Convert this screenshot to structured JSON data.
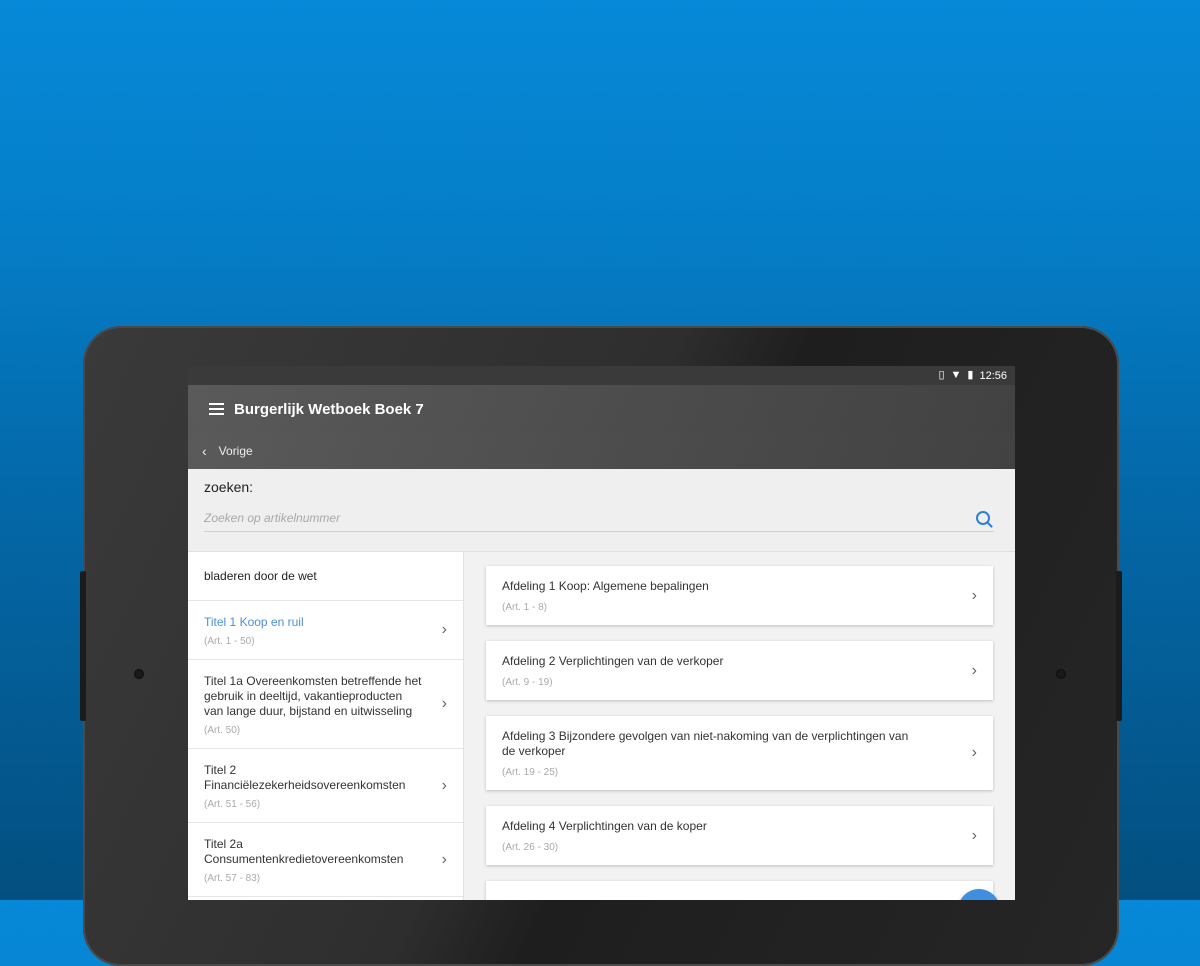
{
  "statusbar": {
    "time": "12:56",
    "icons": [
      "vibrate-icon",
      "wifi-icon",
      "battery-icon"
    ]
  },
  "appbar": {
    "title": "Burgerlijk Wetboek Boek 7",
    "menu_icon": "menu-icon"
  },
  "subbar": {
    "back_label": "Vorige"
  },
  "search": {
    "label": "zoeken:",
    "placeholder": "Zoeken op artikelnummer",
    "value": ""
  },
  "left": {
    "heading": "bladeren door de wet",
    "items": [
      {
        "name": "Titel 1 Koop en ruil",
        "art": "(Art. 1 - 50)",
        "active": true
      },
      {
        "name": "Titel 1a Overeenkomsten betreffende het gebruik in deeltijd, vakantieproducten van lange duur, bijstand en uitwisseling",
        "art": "(Art. 50)",
        "active": false
      },
      {
        "name": "Titel 2 Financiëlezekerheidsovereenkomsten",
        "art": "(Art. 51 - 56)",
        "active": false
      },
      {
        "name": "Titel 2a Consumentenkredietovereenkomsten",
        "art": "(Art. 57 - 83)",
        "active": false
      }
    ]
  },
  "right": {
    "cards": [
      {
        "title": "Afdeling 1 Koop: Algemene bepalingen",
        "art": "(Art. 1 - 8)"
      },
      {
        "title": "Afdeling 2 Verplichtingen van de verkoper",
        "art": "(Art. 9 - 19)"
      },
      {
        "title": "Afdeling 3 Bijzondere gevolgen van niet-nakoming van de verplichtingen van de verkoper",
        "art": "(Art. 19 - 25)"
      },
      {
        "title": "Afdeling 4 Verplichtingen van de koper",
        "art": "(Art. 26 - 30)"
      },
      {
        "title": "",
        "art": ""
      }
    ]
  },
  "colors": {
    "accent": "#4a8fd8",
    "appbar": "#4c4c4c",
    "background_top": "#0689d8",
    "background_bottom": "#034f80"
  }
}
